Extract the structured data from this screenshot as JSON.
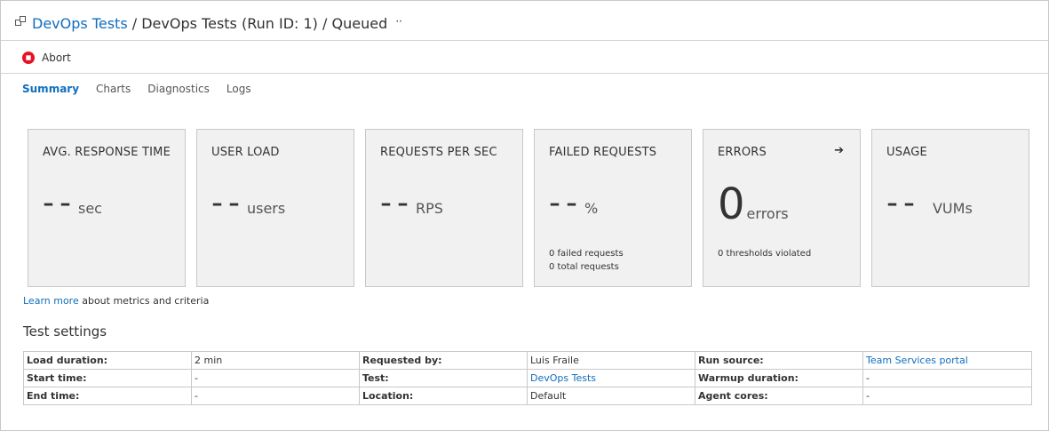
{
  "breadcrumb": {
    "link": "DevOps Tests",
    "sep1": "/",
    "run": "DevOps Tests (Run ID: 1)",
    "sep2": "/",
    "status": "Queued",
    "more": "··"
  },
  "toolbar": {
    "abort_label": "Abort"
  },
  "tabs": [
    "Summary",
    "Charts",
    "Diagnostics",
    "Logs"
  ],
  "active_tab": "Summary",
  "metrics": [
    {
      "title": "AVG. RESPONSE TIME",
      "value": "--",
      "unit": "sec"
    },
    {
      "title": "USER LOAD",
      "value": "--",
      "unit": "users"
    },
    {
      "title": "REQUESTS PER SEC",
      "value": "--",
      "unit": "RPS"
    },
    {
      "title": "FAILED REQUESTS",
      "value": "--",
      "unit": "%",
      "sub": [
        "0 failed requests",
        "0 total requests"
      ]
    },
    {
      "title": "ERRORS",
      "value": "0",
      "unit": "errors",
      "sub": [
        "0 thresholds violated"
      ],
      "arrow": "➔"
    },
    {
      "title": "USAGE",
      "value": "--",
      "unit": "VUMs"
    }
  ],
  "learn_more": {
    "link": "Learn more",
    "text": " about metrics and criteria"
  },
  "test_settings": {
    "title": "Test settings",
    "rows": [
      [
        {
          "label": "Load duration:",
          "value": "2 min"
        },
        {
          "label": "Requested by:",
          "value": "Luis Fraile"
        },
        {
          "label": "Run source:",
          "value": "Team Services portal",
          "link": true
        }
      ],
      [
        {
          "label": "Start time:",
          "value": "-"
        },
        {
          "label": "Test:",
          "value": "DevOps Tests",
          "link": true
        },
        {
          "label": "Warmup duration:",
          "value": "-"
        }
      ],
      [
        {
          "label": "End time:",
          "value": "-"
        },
        {
          "label": "Location:",
          "value": "Default"
        },
        {
          "label": "Agent cores:",
          "value": "-"
        }
      ]
    ]
  },
  "colors": {
    "accent": "#106ebe",
    "abort": "#e81123",
    "card_bg": "#f1f1f1"
  }
}
